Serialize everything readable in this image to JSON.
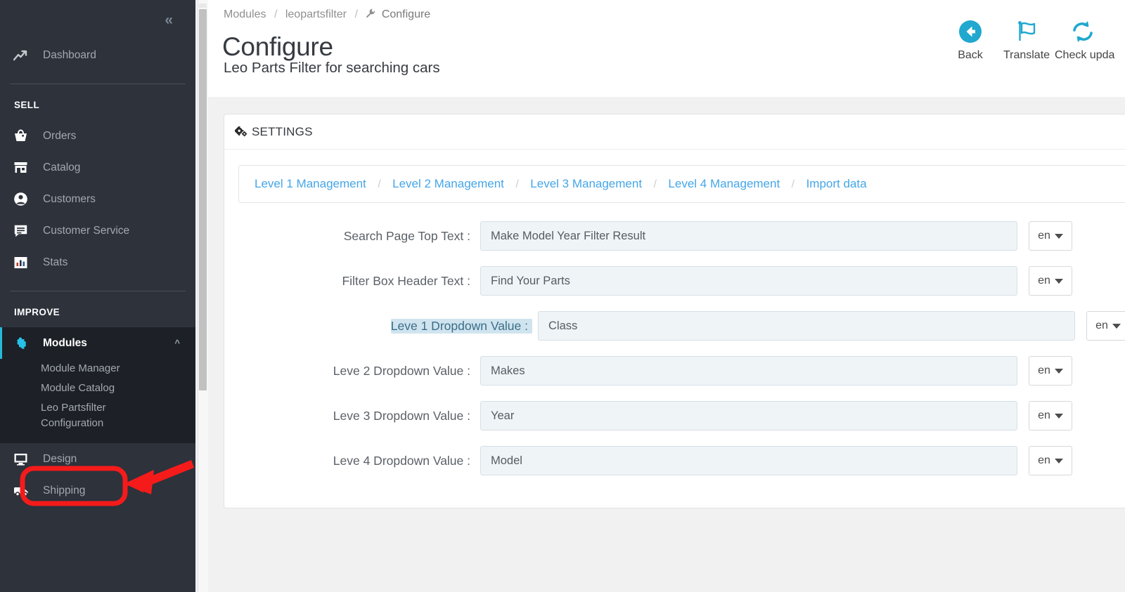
{
  "sidebar": {
    "collapse_icon": "chevron-double-left-icon",
    "top_items": [
      {
        "label": "Dashboard",
        "icon": "trend-up-icon"
      }
    ],
    "sections": [
      {
        "title": "SELL",
        "items": [
          {
            "label": "Orders",
            "icon": "basket-icon"
          },
          {
            "label": "Catalog",
            "icon": "store-icon"
          },
          {
            "label": "Customers",
            "icon": "person-circle-icon"
          },
          {
            "label": "Customer Service",
            "icon": "chat-icon"
          },
          {
            "label": "Stats",
            "icon": "bar-chart-icon"
          }
        ]
      },
      {
        "title": "IMPROVE",
        "items": [
          {
            "label": "Modules",
            "icon": "puzzle-icon",
            "active": true,
            "expanded": true,
            "sub": [
              "Module Manager",
              "Module Catalog",
              "Leo Partsfilter Configuration"
            ]
          },
          {
            "label": "Design",
            "icon": "monitor-icon"
          },
          {
            "label": "Shipping",
            "icon": "truck-icon"
          }
        ]
      }
    ]
  },
  "breadcrumb": {
    "items": [
      "Modules",
      "leopartsfilter"
    ],
    "separator": "/",
    "current": "Configure",
    "current_icon": "wrench-icon"
  },
  "header": {
    "title": "Configure",
    "subtitle": "Leo Parts Filter for searching cars"
  },
  "toolbar": {
    "items": [
      {
        "label": "Back",
        "icon": "arrow-left-circle-icon"
      },
      {
        "label": "Translate",
        "icon": "flag-icon"
      },
      {
        "label": "Check upda",
        "icon": "refresh-icon"
      }
    ]
  },
  "panel": {
    "title": "SETTINGS",
    "title_icon": "gears-icon",
    "tabs": [
      "Level 1 Management",
      "Level 2 Management",
      "Level 3 Management",
      "Level 4 Management",
      "Import data"
    ],
    "tab_separator": "/",
    "fields": [
      {
        "label": "Search Page Top Text :",
        "value": "Make Model Year Filter Result",
        "lang": "en",
        "selected": false
      },
      {
        "label": "Filter Box Header Text :",
        "value": "Find Your Parts",
        "lang": "en",
        "selected": false
      },
      {
        "label": "Leve 1 Dropdown Value :",
        "value": "Class",
        "lang": "en",
        "selected": true
      },
      {
        "label": "Leve 2 Dropdown Value :",
        "value": "Makes",
        "lang": "en",
        "selected": false
      },
      {
        "label": "Leve 3 Dropdown Value :",
        "value": "Year",
        "lang": "en",
        "selected": false
      },
      {
        "label": "Leve 4 Dropdown Value :",
        "value": "Model",
        "lang": "en",
        "selected": false
      }
    ]
  },
  "annotation": {
    "highlight_target": "Leo Partsfilter Configuration",
    "color": "#f51b1b",
    "shapes": [
      "rounded-rect-highlight",
      "arrow-pointing-left-down"
    ]
  },
  "colors": {
    "sidebar_bg": "#2d323b",
    "sidebar_active_bg": "#1d2127",
    "accent": "#25b9d7",
    "link": "#45a6e8",
    "content_bg": "#f1f1f1",
    "input_bg": "#eff4f7",
    "annotation_red": "#f51b1b"
  }
}
